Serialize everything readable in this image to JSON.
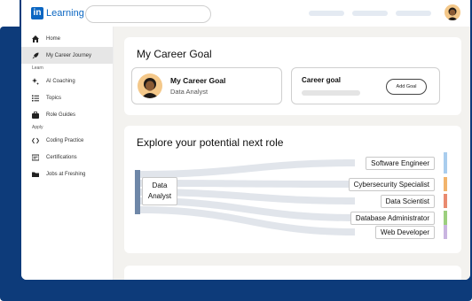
{
  "app": {
    "logo_mark": "in",
    "logo_text": "Learning"
  },
  "sidebar": {
    "items": [
      {
        "label": "Home",
        "icon": "home-icon"
      },
      {
        "label": "My Career Journey",
        "icon": "rocket-icon",
        "active": true
      }
    ],
    "section_learn": "Learn",
    "learn_items": [
      {
        "label": "AI Coaching",
        "icon": "sparkle-icon"
      },
      {
        "label": "Topics",
        "icon": "list-icon"
      },
      {
        "label": "Role Guides",
        "icon": "briefcase-icon"
      }
    ],
    "section_apply": "Apply",
    "apply_items": [
      {
        "label": "Coding Practice",
        "icon": "code-icon"
      },
      {
        "label": "Certifications",
        "icon": "certificate-icon"
      },
      {
        "label": "Jobs at Freshing",
        "icon": "folder-icon"
      }
    ]
  },
  "career_goal": {
    "title": "My Career Goal",
    "profile_title": "My Career Goal",
    "profile_subtitle": "Data Analyst",
    "goal_label": "Career goal",
    "add_button": "Add Goal"
  },
  "explore": {
    "title": "Explore your potential next role",
    "source": {
      "line1": "Data",
      "line2": "Analyst"
    },
    "roles": [
      {
        "label": "Software Engineer",
        "color": "#a9cdee"
      },
      {
        "label": "Cybersecurity Specialist",
        "color": "#f2b46b"
      },
      {
        "label": "Data Scientist",
        "color": "#e98a6f"
      },
      {
        "label": "Database Administrator",
        "color": "#9ccf7e"
      },
      {
        "label": "Web Developer",
        "color": "#c9b4e0"
      }
    ]
  },
  "colors": {
    "brand": "#0a66c2",
    "frame": "#0d3b7a",
    "source_bar": "#6f87a8",
    "flow": "#d9dee6"
  }
}
